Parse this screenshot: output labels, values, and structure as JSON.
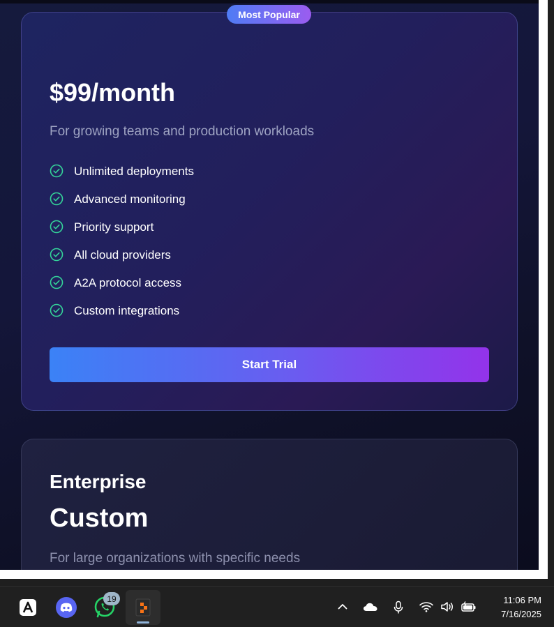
{
  "pricing": {
    "pro": {
      "badge": "Most Popular",
      "price": "$99/month",
      "description": "For growing teams and production workloads",
      "features": [
        "Unlimited deployments",
        "Advanced monitoring",
        "Priority support",
        "All cloud providers",
        "A2A protocol access",
        "Custom integrations"
      ],
      "cta_label": "Start Trial"
    },
    "enterprise": {
      "name": "Enterprise",
      "price": "Custom",
      "description": "For large organizations with specific needs"
    }
  },
  "colors": {
    "accent_start": "#3b82f6",
    "accent_end": "#9333ea",
    "check_green": "#34d399"
  },
  "taskbar": {
    "apps": [
      {
        "icon": "a-logo-icon"
      },
      {
        "icon": "discord-icon"
      },
      {
        "icon": "whatsapp-icon",
        "badge": "19"
      },
      {
        "icon": "app-icon-active"
      }
    ],
    "tray": [
      "chevron-up-icon",
      "cloud-icon",
      "microphone-icon",
      "wifi-icon",
      "volume-icon",
      "battery-icon"
    ],
    "time": "11:06 PM",
    "date": "7/16/2025"
  }
}
